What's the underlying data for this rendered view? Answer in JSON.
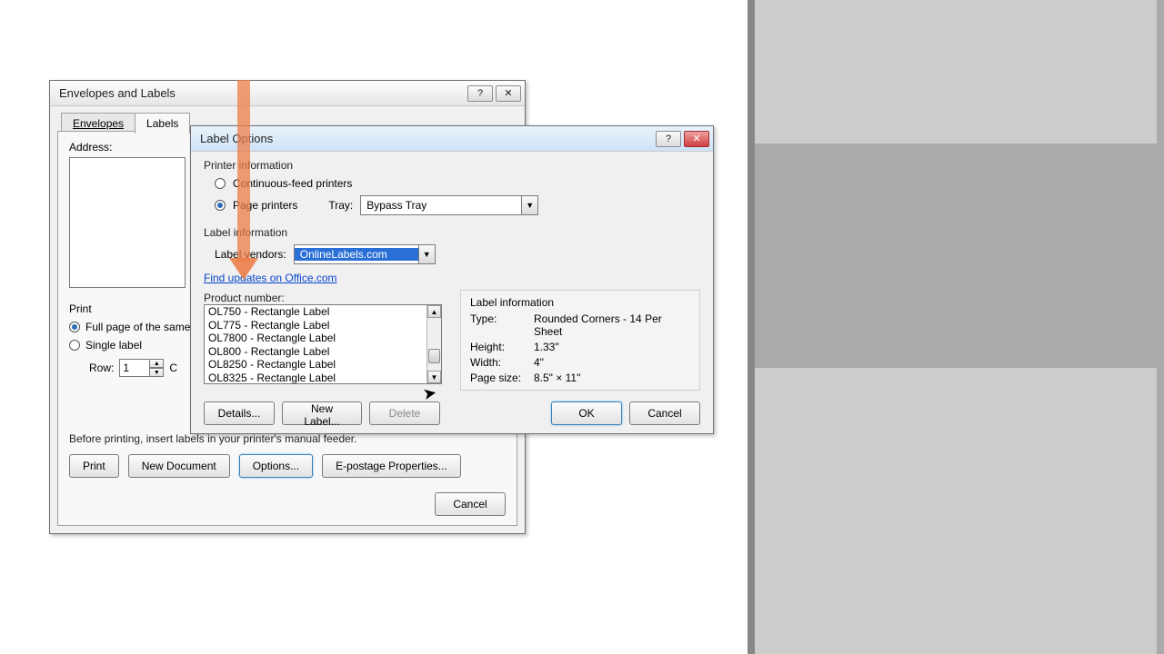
{
  "envelopes_dialog": {
    "title": "Envelopes and Labels",
    "tabs": {
      "envelopes": "Envelopes",
      "labels": "Labels",
      "active": "labels"
    },
    "address_label": "Address:",
    "print_section": "Print",
    "print_full": "Full page of the same label",
    "print_single": "Single label",
    "row_label": "Row:",
    "row_value": "1",
    "col_label": "C",
    "hint": "Before printing, insert labels in your printer's manual feeder.",
    "buttons": {
      "print": "Print",
      "new_document": "New Document",
      "options": "Options...",
      "epostage": "E-postage Properties...",
      "cancel": "Cancel"
    }
  },
  "label_options": {
    "title": "Label Options",
    "printer_info": "Printer information",
    "radio_continuous": "Continuous-feed printers",
    "radio_page": "Page printers",
    "tray_label": "Tray:",
    "tray_value": "Bypass Tray",
    "label_info_title": "Label information",
    "vendor_label": "Label vendors:",
    "vendor_value": "OnlineLabels.com",
    "updates_link": "Find updates on Office.com",
    "product_number_label": "Product number:",
    "products": [
      "OL750 - Rectangle Label",
      "OL775 - Rectangle Label",
      "OL7800 - Rectangle Label",
      "OL800 - Rectangle Label",
      "OL8250 - Rectangle Label",
      "OL8325 - Rectangle Label"
    ],
    "info_panel": {
      "title": "Label information",
      "type_label": "Type:",
      "type_value": "Rounded Corners - 14 Per Sheet",
      "height_label": "Height:",
      "height_value": "1.33\"",
      "width_label": "Width:",
      "width_value": "4\"",
      "page_label": "Page size:",
      "page_value": "8.5\" × 11\""
    },
    "buttons": {
      "details": "Details...",
      "new_label": "New Label...",
      "delete": "Delete",
      "ok": "OK",
      "cancel": "Cancel"
    }
  }
}
